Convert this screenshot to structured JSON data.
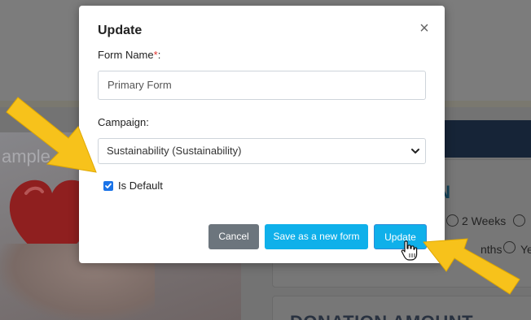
{
  "background": {
    "photo_text": "ample",
    "card_title": "ON",
    "radio_options": [
      "2 Weeks",
      "nths",
      "Ye"
    ],
    "donation_heading": "DONATION AMOUNT"
  },
  "modal": {
    "title": "Update",
    "close_glyph": "×",
    "form_name": {
      "label": "Form Name",
      "required_mark": "*",
      "colon": ":",
      "value": "Primary Form"
    },
    "campaign": {
      "label": "Campaign:",
      "selected": "Sustainability (Sustainability)"
    },
    "is_default": {
      "label": "Is Default",
      "checked": true
    },
    "buttons": {
      "cancel": "Cancel",
      "save_new": "Save as a new form",
      "update": "Update"
    }
  },
  "annotations": {
    "arrow_color": "#f7c21b",
    "icons": [
      "arrow-pointing-to-checkbox",
      "arrow-pointing-to-update-button",
      "hand-cursor-icon"
    ]
  }
}
